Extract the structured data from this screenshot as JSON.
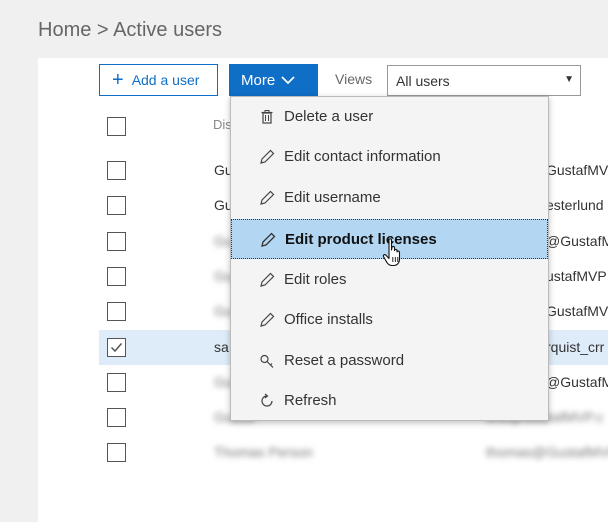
{
  "breadcrumb": {
    "home": "Home",
    "separator": ">",
    "current": "Active users"
  },
  "toolbar": {
    "add_user_label": "Add a user",
    "more_label": "More",
    "views_label": "Views",
    "views_value": "All users"
  },
  "table": {
    "header_display_name": "Dis",
    "rows": [
      {
        "name": "Gu",
        "email": "GustafMV",
        "checked": false
      },
      {
        "name": "Gu",
        "email": "esterlund",
        "checked": false
      },
      {
        "name": "Gustaf",
        "email": "@GustafM",
        "checked": false
      },
      {
        "name": "Gustaf",
        "email": "ustafMVP",
        "checked": false
      },
      {
        "name": "Gustaf",
        "email": "GustafMV",
        "checked": false
      },
      {
        "name": "sa",
        "email": "rquist_crr",
        "checked": true
      },
      {
        "name": "Gustaf",
        "email": "@GustafM",
        "checked": false
      },
      {
        "name": "Gustaf",
        "email": "test@GustafMVP.c",
        "checked": false
      },
      {
        "name": "Thomas Person",
        "email": "thomas@GustafMVP",
        "checked": false
      }
    ]
  },
  "menu": {
    "items": [
      {
        "label": "Delete a user",
        "icon": "trash-icon"
      },
      {
        "label": "Edit contact information",
        "icon": "pencil-icon"
      },
      {
        "label": "Edit username",
        "icon": "pencil-icon"
      },
      {
        "label": "Edit product licenses",
        "icon": "pencil-icon"
      },
      {
        "label": "Edit roles",
        "icon": "pencil-icon"
      },
      {
        "label": "Office installs",
        "icon": "pencil-icon"
      },
      {
        "label": "Reset a password",
        "icon": "key-icon"
      },
      {
        "label": "Refresh",
        "icon": "refresh-icon"
      }
    ],
    "active_index": 3
  },
  "colors": {
    "accent": "#0f6fc6",
    "selected_row": "#deecf9",
    "menu_highlight": "#b3d7f3"
  }
}
